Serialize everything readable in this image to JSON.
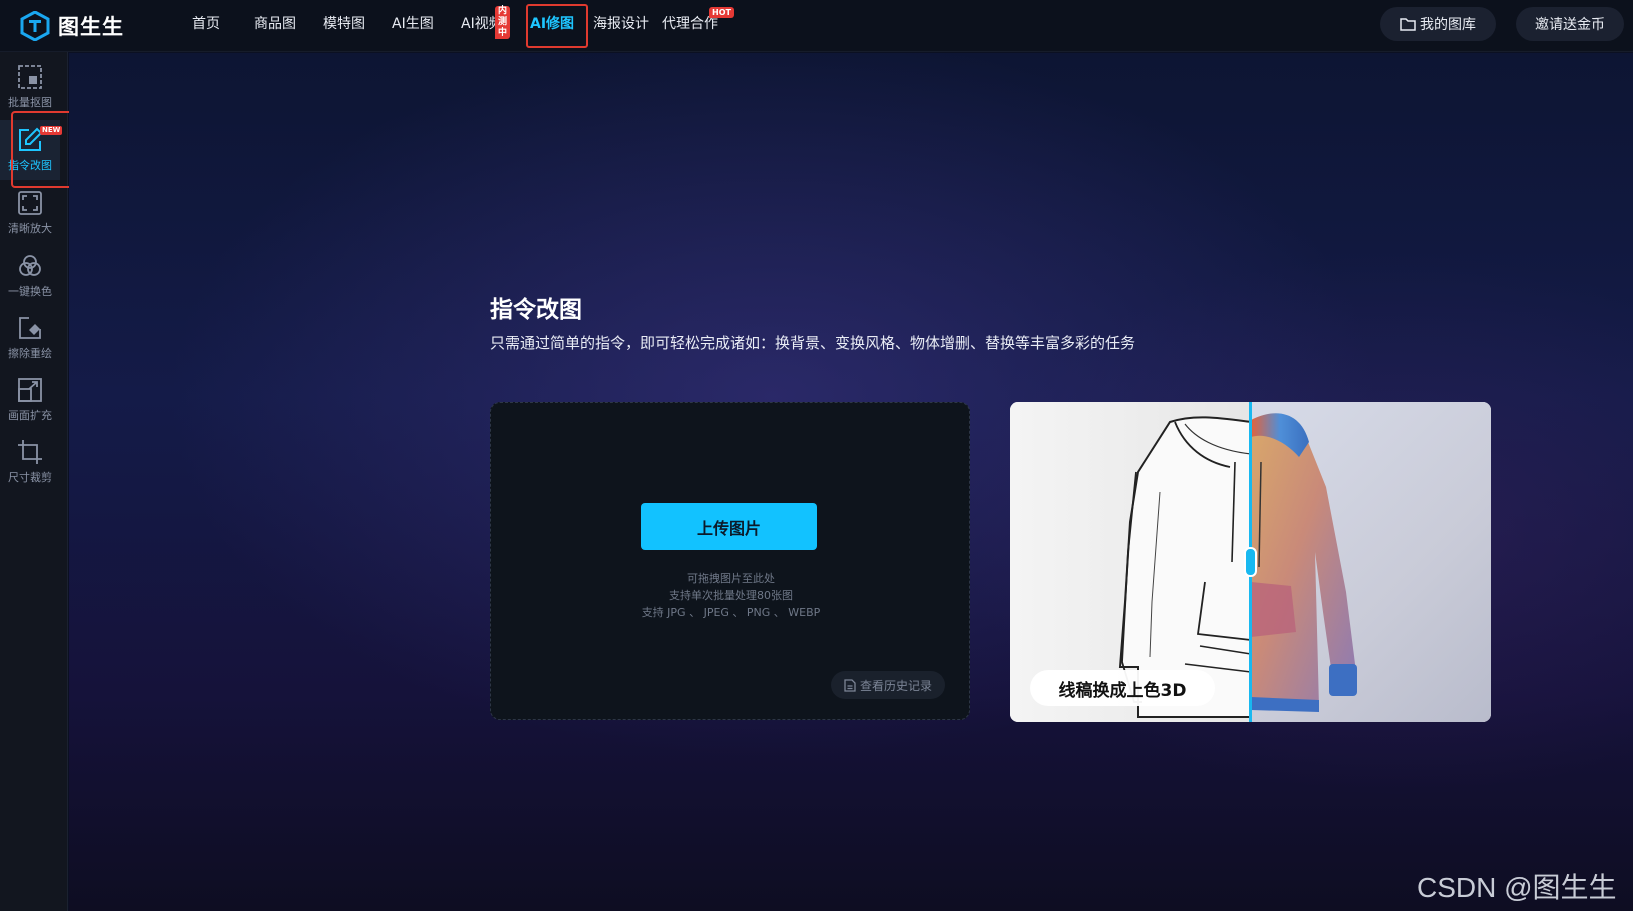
{
  "app": {
    "logo_text": "图生生"
  },
  "nav": {
    "items": [
      {
        "label": "首页"
      },
      {
        "label": "商品图"
      },
      {
        "label": "模特图"
      },
      {
        "label": "AI生图"
      },
      {
        "label": "AI视频",
        "badge": "内测中"
      },
      {
        "label": "AI修图",
        "active": true
      },
      {
        "label": "海报设计"
      },
      {
        "label": "代理合作",
        "badge": "HOT"
      }
    ],
    "my_gallery": "我的图库",
    "invite": "邀请送金币"
  },
  "sidebar": {
    "items": [
      {
        "label": "批量抠图",
        "icon": "batch-cutout-icon"
      },
      {
        "label": "指令改图",
        "icon": "edit-icon",
        "badge": "NEW",
        "active": true
      },
      {
        "label": "清晰放大",
        "icon": "upscale-icon"
      },
      {
        "label": "一键换色",
        "icon": "color-swap-icon"
      },
      {
        "label": "擦除重绘",
        "icon": "erase-icon"
      },
      {
        "label": "画面扩充",
        "icon": "expand-icon"
      },
      {
        "label": "尺寸裁剪",
        "icon": "crop-icon"
      }
    ]
  },
  "main": {
    "title": "指令改图",
    "subtitle": "只需通过简单的指令，即可轻松完成诸如：换背景、变换风格、物体增删、替换等丰富多彩的任务",
    "upload": {
      "button": "上传图片",
      "hint1": "可拖拽图片至此处",
      "hint2": "支持单次批量处理80张图",
      "hint3": "支持 JPG 、 JPEG 、 PNG 、 WEBP",
      "history": "查看历史记录"
    },
    "preview": {
      "label": "线稿换成上色3D"
    }
  },
  "watermark": "CSDN @图生生"
}
